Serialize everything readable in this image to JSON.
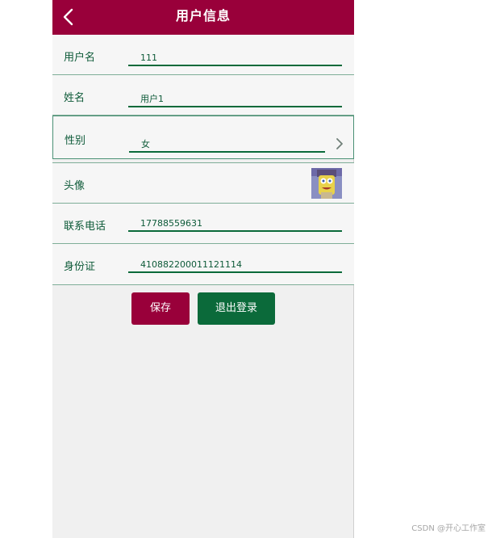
{
  "header": {
    "title": "用户信息",
    "back_icon": "chevron-left-icon"
  },
  "form": {
    "username": {
      "label": "用户名",
      "value": "111"
    },
    "name": {
      "label": "姓名",
      "value": "用户1"
    },
    "gender": {
      "label": "性别",
      "value": "女",
      "icon": "chevron-right-icon"
    },
    "avatar": {
      "label": "头像",
      "icon": "avatar-image"
    },
    "phone": {
      "label": "联系电话",
      "value": "17788559631"
    },
    "id_card": {
      "label": "身份证",
      "value": "410882200011121114"
    }
  },
  "buttons": {
    "save_label": "保存",
    "logout_label": "退出登录"
  },
  "watermark": "CSDN @开心工作室",
  "colors": {
    "primary": "#99003a",
    "secondary": "#0b6a3a",
    "text": "#0d5a38",
    "background": "#f0f0f0"
  }
}
